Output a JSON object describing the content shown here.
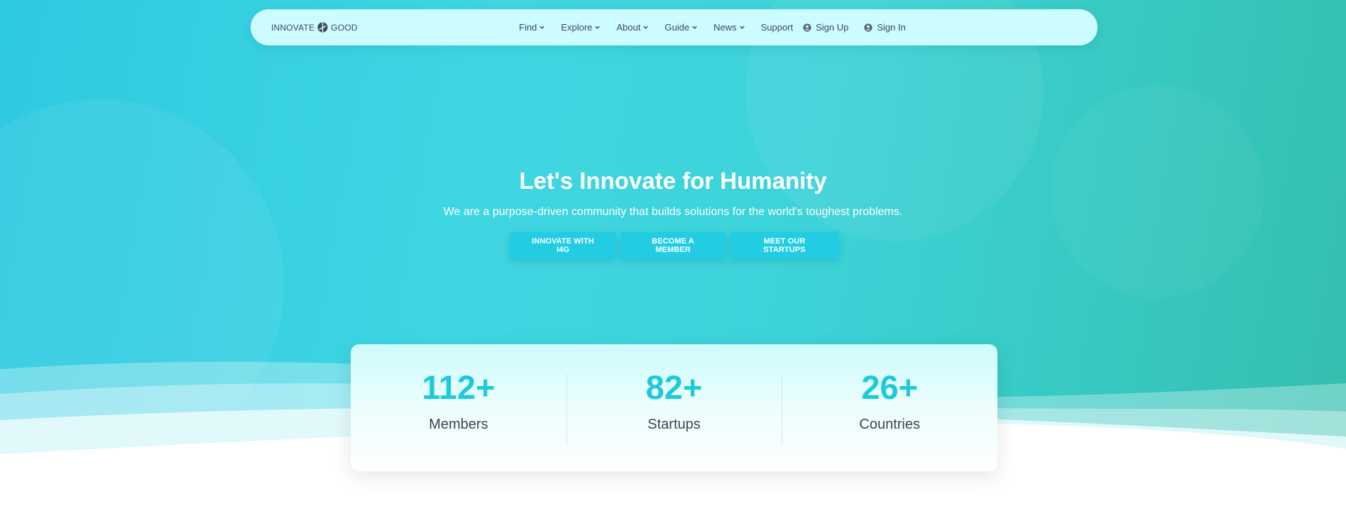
{
  "brand": {
    "left": "INNOVATE",
    "right": "GOOD",
    "logo_icon": "i4g-logo-icon"
  },
  "nav": {
    "items": [
      {
        "label": "Find",
        "dropdown": true
      },
      {
        "label": "Explore",
        "dropdown": true
      },
      {
        "label": "About",
        "dropdown": true
      },
      {
        "label": "Guide",
        "dropdown": true
      },
      {
        "label": "News",
        "dropdown": true
      },
      {
        "label": "Support",
        "dropdown": false
      }
    ],
    "sign_up": "Sign Up",
    "sign_in": "Sign In",
    "user_icon": "user-circle-icon"
  },
  "hero": {
    "title": "Let's Innovate for Humanity",
    "subtitle": "We are a purpose-driven community that builds solutions for the world's toughest problems.",
    "buttons": [
      "INNOVATE WITH I4G",
      "BECOME A MEMBER",
      "MEET OUR STARTUPS"
    ]
  },
  "stats": [
    {
      "value": "112+",
      "label": "Members"
    },
    {
      "value": "82+",
      "label": "Startups"
    },
    {
      "value": "26+",
      "label": "Countries"
    }
  ],
  "colors": {
    "accent": "#1ec9dc",
    "button": "#22cde4",
    "nav_bg": "#ccfcff",
    "text_dark": "#3b4656"
  }
}
